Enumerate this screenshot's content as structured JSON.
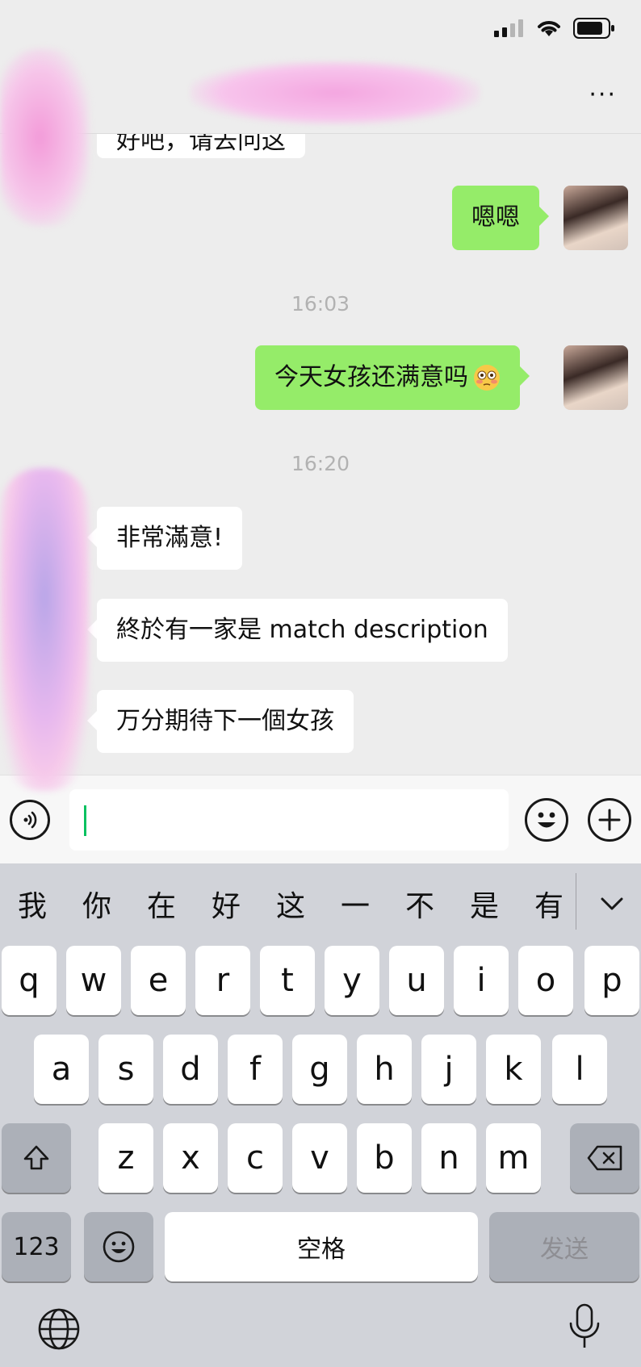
{
  "status_bar": {
    "signal_icon": "signal-bars-icon",
    "wifi_icon": "wifi-icon",
    "battery_icon": "battery-icon"
  },
  "nav": {
    "more_icon": "more-dots-icon",
    "more_label": "···"
  },
  "chat": {
    "partial_top_text": "好吧，请去问这",
    "messages": [
      {
        "side": "out",
        "text": "嗯嗯"
      },
      {
        "timestamp": "16:03"
      },
      {
        "side": "out",
        "text": "今天女孩还满意吗",
        "emoji": "flushed-face-emoji"
      },
      {
        "timestamp": "16:20"
      },
      {
        "side": "in",
        "text": "非常滿意!"
      },
      {
        "side": "in",
        "text": "終於有一家是 match description"
      },
      {
        "side": "in",
        "text": "万分期待下一個女孩"
      }
    ]
  },
  "input_bar": {
    "voice_icon": "voice-icon",
    "emoji_icon": "emoji-icon",
    "plus_icon": "plus-icon",
    "text_value": ""
  },
  "keyboard": {
    "candidates": [
      "我",
      "你",
      "在",
      "好",
      "这",
      "一",
      "不",
      "是",
      "有"
    ],
    "row1": [
      "q",
      "w",
      "e",
      "r",
      "t",
      "y",
      "u",
      "i",
      "o",
      "p"
    ],
    "row2": [
      "a",
      "s",
      "d",
      "f",
      "g",
      "h",
      "j",
      "k",
      "l"
    ],
    "row3": [
      "z",
      "x",
      "c",
      "v",
      "b",
      "n",
      "m"
    ],
    "numbers_label": "123",
    "space_label": "空格",
    "send_label": "发送",
    "shift_icon": "shift-icon",
    "delete_icon": "delete-icon",
    "emoji_key_icon": "emoji-icon",
    "globe_icon": "globe-icon",
    "mic_icon": "microphone-icon",
    "collapse_icon": "chevron-down-icon"
  },
  "colors": {
    "outgoing_bubble": "#95ec69",
    "incoming_bubble": "#ffffff",
    "background": "#ededed",
    "caret": "#07c160"
  }
}
